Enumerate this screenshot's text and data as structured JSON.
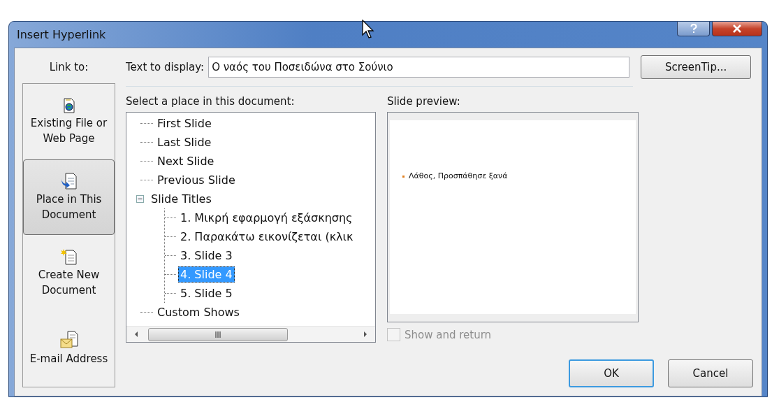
{
  "window": {
    "title": "Insert Hyperlink"
  },
  "link_to": {
    "label": "Link to:",
    "items": [
      {
        "label": "Existing File or\nWeb Page",
        "selected": false
      },
      {
        "label": "Place in This\nDocument",
        "selected": true
      },
      {
        "label": "Create New\nDocument",
        "selected": false
      },
      {
        "label": "E-mail Address",
        "selected": false
      }
    ]
  },
  "text_to_display": {
    "label": "Text to display:",
    "value": "Ο ναός του Ποσειδώνα στο Σούνιο"
  },
  "screentip_button": "ScreenTip...",
  "place": {
    "label": "Select a place in this document:",
    "tree": [
      {
        "label": "First Slide",
        "selected": false
      },
      {
        "label": "Last Slide",
        "selected": false
      },
      {
        "label": "Next Slide",
        "selected": false
      },
      {
        "label": "Previous Slide",
        "selected": false
      },
      {
        "label": "Slide Titles",
        "selected": false,
        "expanded": true,
        "children": [
          {
            "label": "1. Μικρή εφαρμογή εξάσκησης",
            "selected": false
          },
          {
            "label": "2. Παρακάτω εικονίζεται (κλικ",
            "selected": false
          },
          {
            "label": "3. Slide 3",
            "selected": false
          },
          {
            "label": "4. Slide 4",
            "selected": true
          },
          {
            "label": "5. Slide 5",
            "selected": false
          }
        ]
      },
      {
        "label": "Custom Shows",
        "selected": false
      }
    ]
  },
  "preview": {
    "label": "Slide preview:",
    "bullet_text": "Λάθος, Προσπάθησε ξανά"
  },
  "show_and_return": {
    "label": "Show and return",
    "checked": false,
    "disabled": true
  },
  "buttons": [
    {
      "label": "OK",
      "default": true
    },
    {
      "label": "Cancel",
      "default": false
    }
  ]
}
